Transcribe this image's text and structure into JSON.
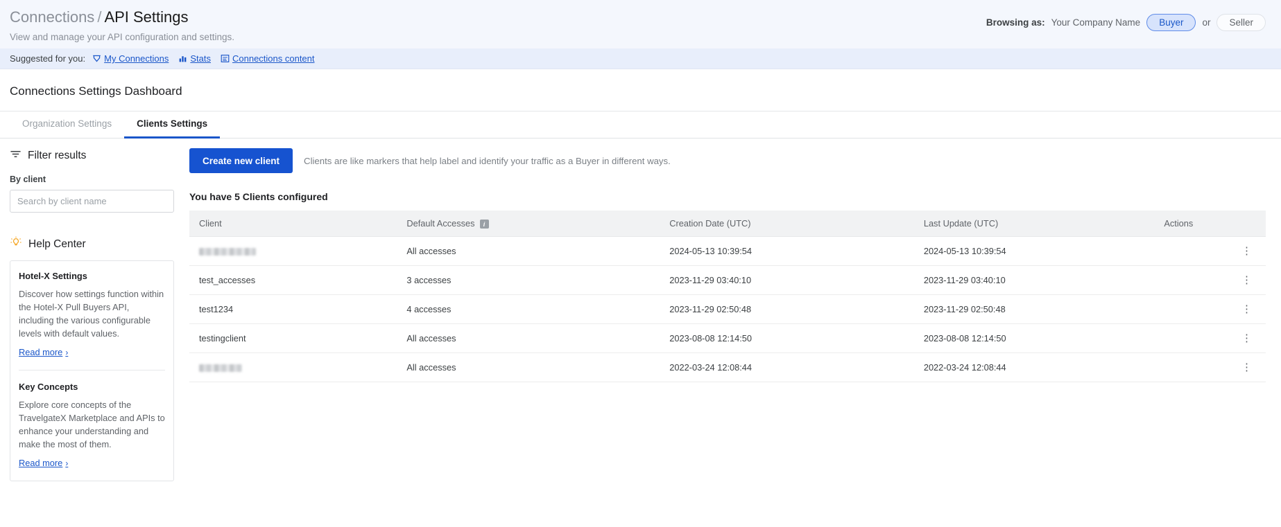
{
  "header": {
    "breadcrumb_parent": "Connections",
    "breadcrumb_separator": "/",
    "breadcrumb_current": "API Settings",
    "subtitle": "View and manage your API configuration and settings.",
    "browsing_label": "Browsing as:",
    "company_name": "Your Company Name",
    "role_buyer": "Buyer",
    "role_or": "or",
    "role_seller": "Seller",
    "accent_color": "#1653d0",
    "pill_active_bg": "#d7e3fc"
  },
  "suggested": {
    "label": "Suggested for you:",
    "links": [
      {
        "label": "My Connections",
        "icon": "connections-icon"
      },
      {
        "label": "Stats",
        "icon": "bar-chart-icon"
      },
      {
        "label": "Connections content",
        "icon": "content-list-icon"
      }
    ]
  },
  "page": {
    "title": "Connections Settings Dashboard"
  },
  "tabs": [
    {
      "label": "Organization Settings",
      "active": false
    },
    {
      "label": "Clients Settings",
      "active": true
    }
  ],
  "sidebar": {
    "filter_title": "Filter results",
    "filter_icon": "filter-icon",
    "by_client_label": "By client",
    "search_placeholder": "Search by client name",
    "search_value": "",
    "help_title": "Help Center",
    "help_icon": "lightbulb-icon",
    "help_items": [
      {
        "title": "Hotel-X Settings",
        "text": "Discover how settings function within the Hotel-X Pull Buyers API, including the various configurable levels with default values.",
        "link": "Read more"
      },
      {
        "title": "Key Concepts",
        "text": "Explore core concepts of the TravelgateX Marketplace and APIs to enhance your understanding and make the most of them.",
        "link": "Read more"
      }
    ]
  },
  "main": {
    "create_button": "Create new client",
    "helper_text": "Clients are like markers that help label and identify your traffic as a Buyer in different ways.",
    "count_text": "You have 5 Clients configured",
    "columns": [
      "Client",
      "Default Accesses",
      "Creation Date (UTC)",
      "Last Update (UTC)",
      "Actions"
    ],
    "default_accesses_info_icon": "info-icon",
    "rows": [
      {
        "client": "",
        "client_redacted": true,
        "accesses": "All accesses",
        "created": "2024-05-13 10:39:54",
        "updated": "2024-05-13 10:39:54",
        "action_icon": "kebab-menu-icon"
      },
      {
        "client": "test_accesses",
        "client_redacted": false,
        "accesses": "3 accesses",
        "created": "2023-11-29 03:40:10",
        "updated": "2023-11-29 03:40:10",
        "action_icon": "kebab-menu-icon"
      },
      {
        "client": "test1234",
        "client_redacted": false,
        "accesses": "4 accesses",
        "created": "2023-11-29 02:50:48",
        "updated": "2023-11-29 02:50:48",
        "action_icon": "kebab-menu-icon"
      },
      {
        "client": "testingclient",
        "client_redacted": false,
        "accesses": "All accesses",
        "created": "2023-08-08 12:14:50",
        "updated": "2023-08-08 12:14:50",
        "action_icon": "kebab-menu-icon"
      },
      {
        "client": "",
        "client_redacted": true,
        "accesses": "All accesses",
        "created": "2022-03-24 12:08:44",
        "updated": "2022-03-24 12:08:44",
        "action_icon": "kebab-menu-icon"
      }
    ]
  }
}
